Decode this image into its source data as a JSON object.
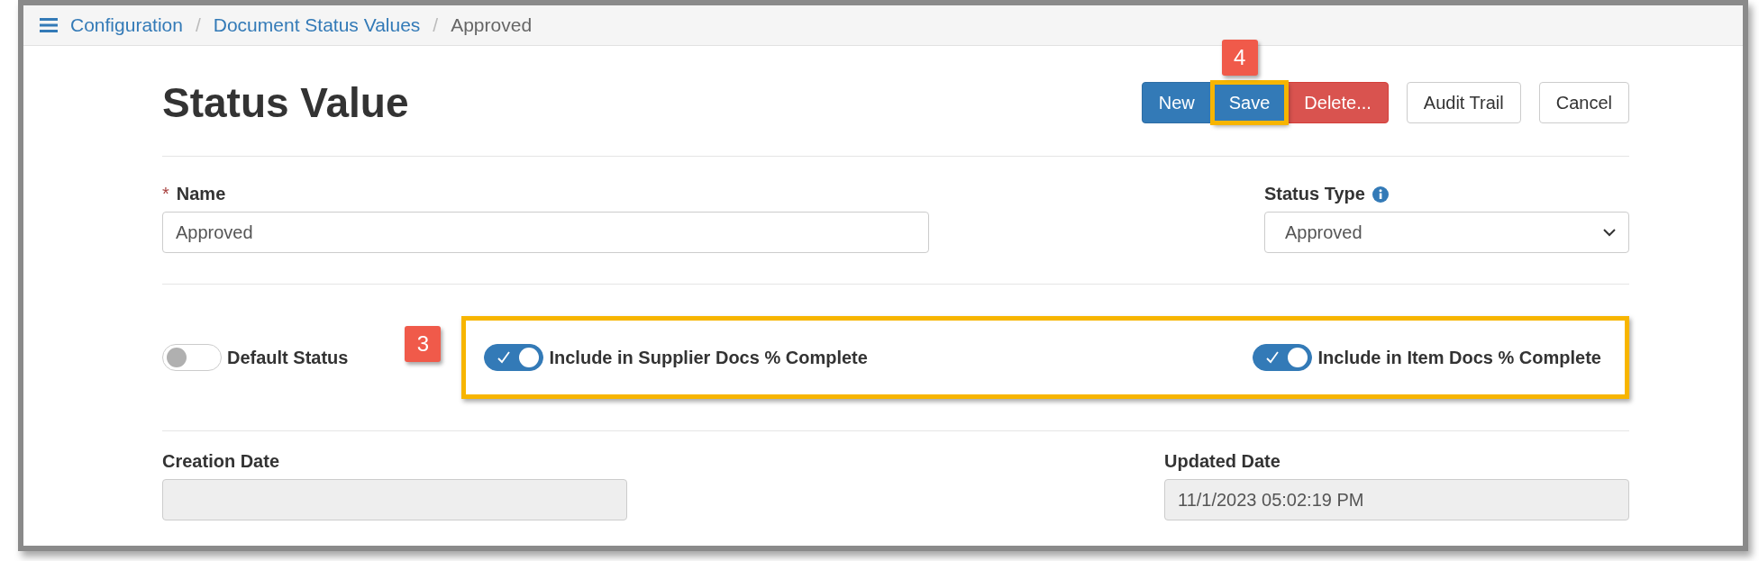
{
  "breadcrumb": [
    {
      "label": "Configuration",
      "kind": "link"
    },
    {
      "label": "Document Status Values",
      "kind": "link"
    },
    {
      "label": "Approved",
      "kind": "current"
    }
  ],
  "breadcrumb_separator": "/",
  "required_mark": "*",
  "page_title": "Status Value",
  "buttons": [
    {
      "label": "New",
      "kind": "primary",
      "highlighted": false
    },
    {
      "label": "Save",
      "kind": "primary",
      "highlighted": true
    },
    {
      "label": "Delete...",
      "kind": "danger",
      "highlighted": false
    },
    {
      "label": "Audit Trail",
      "kind": "default",
      "highlighted": false
    },
    {
      "label": "Cancel",
      "kind": "default",
      "highlighted": false
    }
  ],
  "save_callout": "4",
  "fields": [
    {
      "label": "Name",
      "required": true,
      "kind": "text",
      "value": "Approved",
      "info": false
    },
    {
      "label": "Status Type",
      "required": false,
      "kind": "select",
      "value": "Approved",
      "info": true
    }
  ],
  "toggles": [
    {
      "label": "Default Status",
      "on": false,
      "highlighted": false
    },
    {
      "label": "Include in Supplier Docs % Complete",
      "on": true,
      "highlighted": true
    },
    {
      "label": "Include in Item Docs % Complete",
      "on": true,
      "highlighted": true
    }
  ],
  "toggles_callout": "3",
  "dates": [
    {
      "label": "Creation Date"
    },
    {
      "label": "Updated Date",
      "value": "11/1/2023 05:02:19 PM"
    }
  ]
}
